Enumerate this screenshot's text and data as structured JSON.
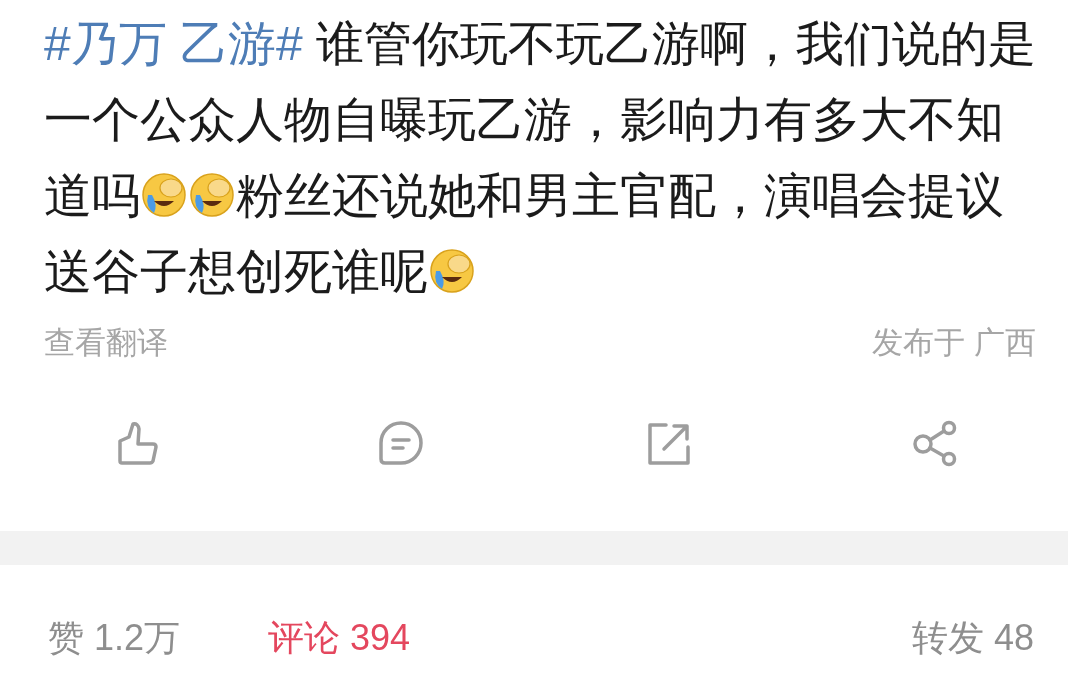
{
  "post": {
    "segments": [
      {
        "kind": "hashtag",
        "text": "#乃万 乙游#"
      },
      {
        "kind": "text",
        "text": " 谁管你玩不玩乙游啊，我们说的是一个公众人物自曝玩乙游，影响力有多大不知道吗"
      },
      {
        "kind": "emoji"
      },
      {
        "kind": "emoji"
      },
      {
        "kind": "text",
        "text": "粉丝还说她和男主官配，演唱会提议送谷子想创死谁呢"
      },
      {
        "kind": "emoji"
      }
    ],
    "translate": "查看翻译",
    "location": "发布于 广西"
  },
  "actions": [
    {
      "kind": "like"
    },
    {
      "kind": "comment"
    },
    {
      "kind": "repost"
    },
    {
      "kind": "share"
    }
  ],
  "stats": [
    {
      "label": "赞 1.2万",
      "selected": false
    },
    {
      "label": "评论 394",
      "selected": true
    },
    {
      "label": "转发 48",
      "selected": false
    }
  ]
}
